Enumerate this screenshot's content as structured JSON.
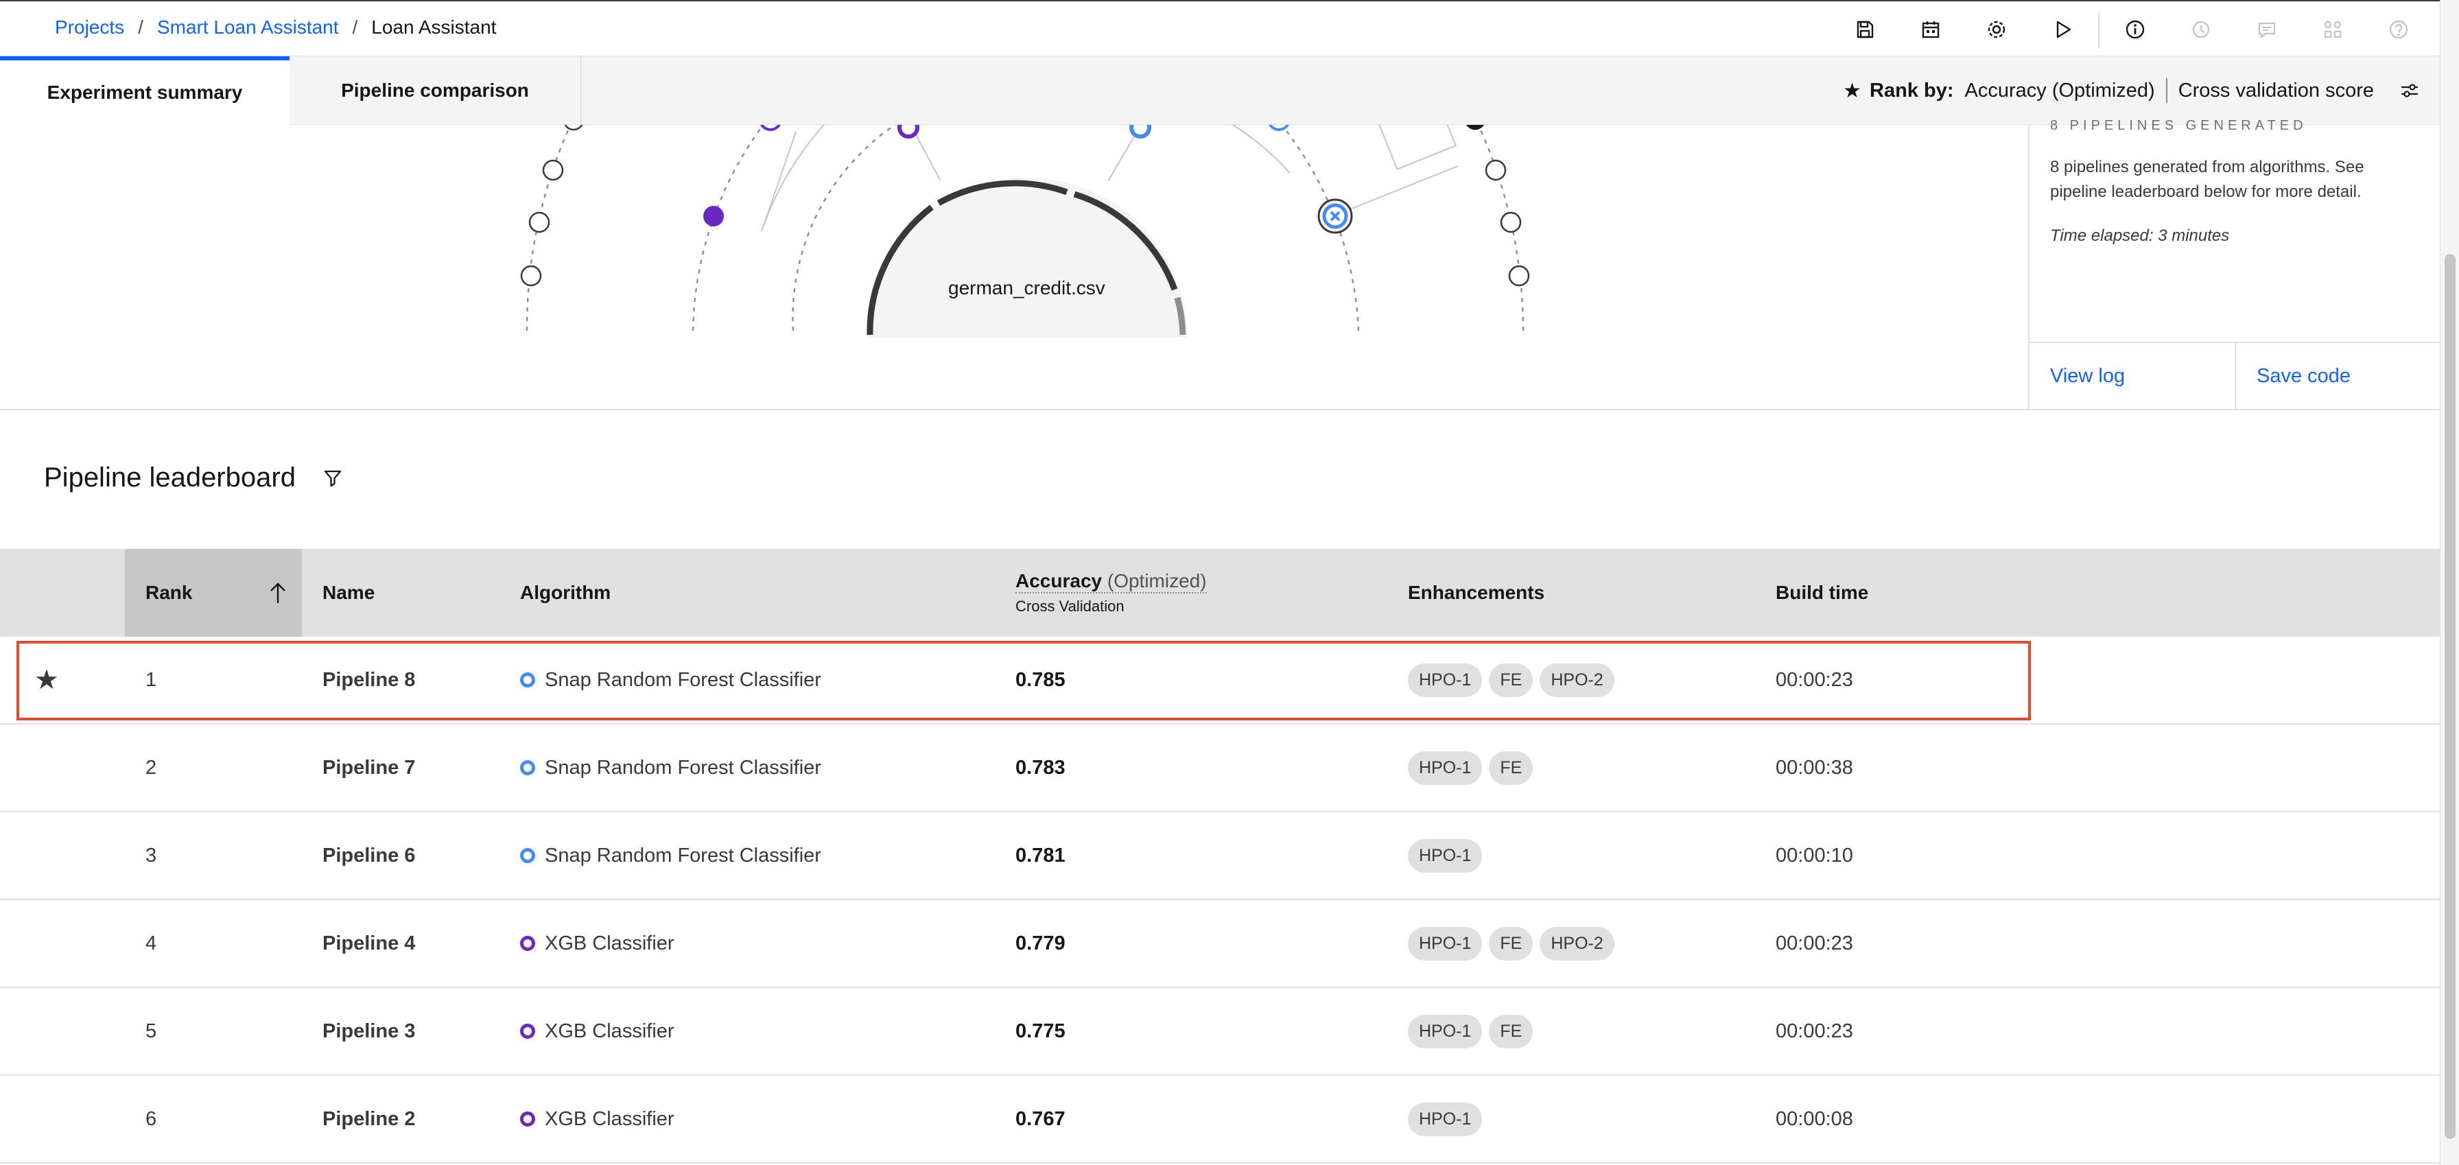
{
  "breadcrumb": {
    "projects": "Projects",
    "project": "Smart Loan Assistant",
    "current": "Loan Assistant"
  },
  "toolbar": {
    "icons": [
      "save-icon",
      "calendar-icon",
      "settings-icon",
      "run-icon",
      "info-icon",
      "history-icon",
      "comment-icon",
      "connections-icon",
      "help-icon"
    ]
  },
  "tabs": {
    "summary": "Experiment summary",
    "comparison": "Pipeline comparison"
  },
  "rank_by": {
    "label": "Rank by:",
    "metric": "Accuracy (Optimized)",
    "score": "Cross validation score"
  },
  "visualization": {
    "dataset": "german_credit.csv"
  },
  "side_panel": {
    "heading": "8 pipelines generated",
    "description": "8 pipelines generated from algorithms. See pipeline leaderboard below for more detail.",
    "time_elapsed": "Time elapsed: 3 minutes",
    "view_log": "View log",
    "save_code": "Save code"
  },
  "leaderboard": {
    "title": "Pipeline leaderboard",
    "columns": {
      "rank": "Rank",
      "name": "Name",
      "algorithm": "Algorithm",
      "accuracy": "Accuracy",
      "accuracy_opt": "(Optimized)",
      "accuracy_sub": "Cross Validation",
      "enhancements": "Enhancements",
      "build_time": "Build time"
    },
    "rows": [
      {
        "rank": "1",
        "name": "Pipeline 8",
        "algorithm": "Snap Random Forest Classifier",
        "accuracy": "0.785",
        "enhancements": [
          "HPO-1",
          "FE",
          "HPO-2"
        ],
        "build_time": "00:00:23",
        "starred": true
      },
      {
        "rank": "2",
        "name": "Pipeline 7",
        "algorithm": "Snap Random Forest Classifier",
        "accuracy": "0.783",
        "enhancements": [
          "HPO-1",
          "FE"
        ],
        "build_time": "00:00:38",
        "starred": false
      },
      {
        "rank": "3",
        "name": "Pipeline 6",
        "algorithm": "Snap Random Forest Classifier",
        "accuracy": "0.781",
        "enhancements": [
          "HPO-1"
        ],
        "build_time": "00:00:10",
        "starred": false
      },
      {
        "rank": "4",
        "name": "Pipeline 4",
        "algorithm": "XGB Classifier",
        "accuracy": "0.779",
        "enhancements": [
          "HPO-1",
          "FE",
          "HPO-2"
        ],
        "build_time": "00:00:23",
        "starred": false
      },
      {
        "rank": "5",
        "name": "Pipeline 3",
        "algorithm": "XGB Classifier",
        "accuracy": "0.775",
        "enhancements": [
          "HPO-1",
          "FE"
        ],
        "build_time": "00:00:23",
        "starred": false
      },
      {
        "rank": "6",
        "name": "Pipeline 2",
        "algorithm": "XGB Classifier",
        "accuracy": "0.767",
        "enhancements": [
          "HPO-1"
        ],
        "build_time": "00:00:08",
        "starred": false
      }
    ]
  },
  "colors": {
    "link": "#0f62fe",
    "snap_rf": "#4589ff",
    "xgb": "#6929c4",
    "highlight": "#e34b2f"
  }
}
